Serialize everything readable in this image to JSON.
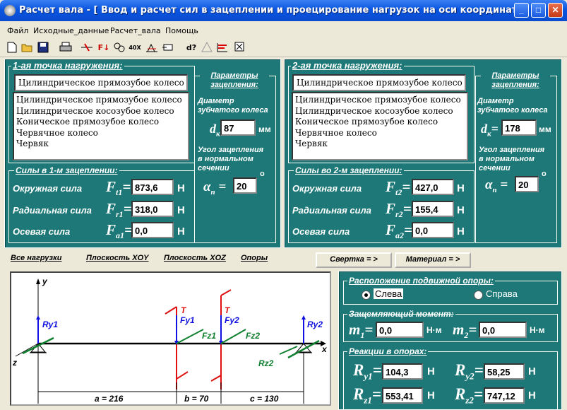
{
  "window": {
    "title": "Расчет вала - [  Ввод и расчет сил в зацеплении и проецирование нагрузок на оси координат]",
    "minimize": "_",
    "maximize": "□",
    "close": "✕"
  },
  "menu": [
    "Файл",
    "Исходные_данные",
    "Расчет_вала",
    "Помощь"
  ],
  "toolbar": {
    "icons": [
      "new-icon",
      "open-icon",
      "save-icon",
      "print-icon",
      "calc-icon",
      "force-icon",
      "link-icon",
      "zoom-icon",
      "graph-icon",
      "export-icon",
      "diameter-icon",
      "tree-icon",
      "chart-icon",
      "close-icon"
    ],
    "zoom_label": "40X",
    "force_label": "F↓",
    "diameter_label": "d?"
  },
  "point1": {
    "title": "1-ая точка нагружения:",
    "combo_value": "Цилиндрическое прямозубое колесо",
    "gear_types": [
      "Цилиндрическое прямозубое колесо",
      "Цилиндрическое косозубое колесо",
      "Коническое прямозубое колесо",
      "Червячное колесо",
      "Червяк"
    ],
    "params_title_1": "Параметры",
    "params_title_2": "зацепления:",
    "diam_label_1": "Диаметр",
    "diam_label_2": "зубчатого колеса",
    "diam_sym": "d",
    "diam_sub": "к",
    "diam_value": "87",
    "diam_unit": "мм",
    "angle_label_1": "Угол зацепления",
    "angle_label_2": "в нормальном",
    "angle_label_3": "сечении",
    "angle_sym": "α",
    "angle_sub": "n",
    "angle_value": "20",
    "angle_unit": "о",
    "forces_title": "Силы в 1-м зацеплении:",
    "forces": [
      {
        "label": "Окружная сила",
        "sym": "F",
        "sub": "t1",
        "value": "873,6",
        "unit": "Н"
      },
      {
        "label": "Радиальная сила",
        "sym": "F",
        "sub": "r1",
        "value": "318,0",
        "unit": "Н"
      },
      {
        "label": "Осевая сила",
        "sym": "F",
        "sub": "a1",
        "value": "0,0",
        "unit": "Н"
      }
    ]
  },
  "point2": {
    "title": "2-ая точка нагружения:",
    "combo_value": "Цилиндрическое прямозубое колесо",
    "gear_types": [
      "Цилиндрическое прямозубое колесо",
      "Цилиндрическое косозубое колесо",
      "Коническое прямозубое колесо",
      "Червячное колесо",
      "Червяк"
    ],
    "params_title_1": "Параметры",
    "params_title_2": "зацепления:",
    "diam_label_1": "Диаметр",
    "diam_label_2": "зубчатого колеса",
    "diam_sym": "d",
    "diam_sub": "к",
    "diam_value": "178",
    "diam_unit": "мм",
    "angle_label_1": "Угол зацепления",
    "angle_label_2": "в нормальном",
    "angle_label_3": "сечении",
    "angle_sym": "α",
    "angle_sub": "n",
    "angle_value": "20",
    "angle_unit": "о",
    "forces_title": "Силы во 2-м зацеплении:",
    "forces": [
      {
        "label": "Окружная сила",
        "sym": "F",
        "sub": "t2",
        "value": "427,0",
        "unit": "Н"
      },
      {
        "label": "Радиальная сила",
        "sym": "F",
        "sub": "r2",
        "value": "155,4",
        "unit": "Н"
      },
      {
        "label": "Осевая сила",
        "sym": "F",
        "sub": "a2",
        "value": "0,0",
        "unit": "Н"
      }
    ]
  },
  "tabs": [
    "Все нагрузки",
    "Плоскость XOY",
    "Плоскость XOZ",
    "Опоры"
  ],
  "buttons": {
    "svertka": "Свертка = >",
    "material": "Материал = >"
  },
  "diagram": {
    "y_axis": "y",
    "z_axis": "z",
    "x_axis": "x",
    "ry1": "Ry1",
    "ry2": "Ry2",
    "fy1": "Fy1",
    "fy2": "Fy2",
    "fz1": "Fz1",
    "fz2": "Fz2",
    "rz2": "Rz2",
    "t1": "T",
    "t2": "T",
    "dim_a": "a =  216",
    "dim_b": "b =  70",
    "dim_c": "c =  130"
  },
  "support": {
    "title": "Расположение подвижной опоры:",
    "left": "Слева",
    "right": "Справа",
    "selected": "left"
  },
  "moment": {
    "title": "Защемляющий момент:",
    "m1_sym": "m",
    "m1_sub": "1",
    "m1_value": "0,0",
    "m2_sym": "m",
    "m2_sub": "2",
    "m2_value": "0,0",
    "unit": "Н·м"
  },
  "reactions": {
    "title": "Реакции в опорах:",
    "items": [
      {
        "sym": "R",
        "sub": "y1",
        "value": "104,3",
        "unit": "Н"
      },
      {
        "sym": "R",
        "sub": "y2",
        "value": "58,25",
        "unit": "Н"
      },
      {
        "sym": "R",
        "sub": "z1",
        "value": "553,41",
        "unit": "Н"
      },
      {
        "sym": "R",
        "sub": "z2",
        "value": "747,12",
        "unit": "Н"
      }
    ]
  },
  "colors": {
    "panel": "#1e7878",
    "titlebar": "#0a55e0",
    "red": "#e01010",
    "blue": "#1010e0",
    "green": "#108030"
  }
}
